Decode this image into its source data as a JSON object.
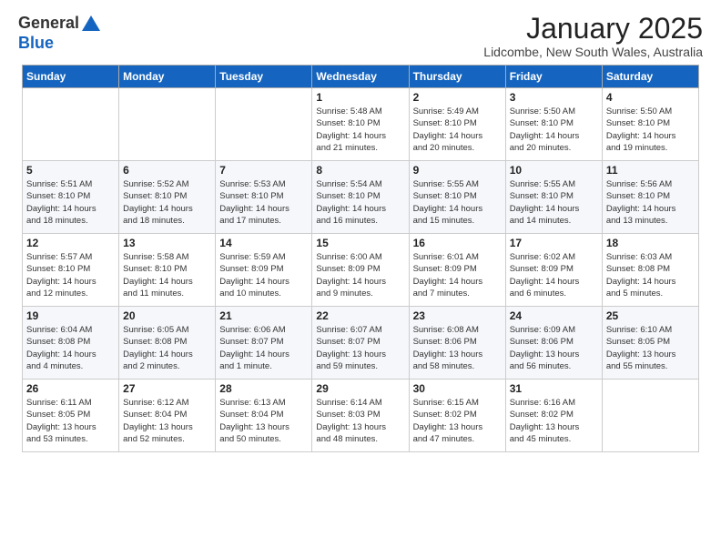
{
  "header": {
    "logo_general": "General",
    "logo_blue": "Blue",
    "month_title": "January 2025",
    "location": "Lidcombe, New South Wales, Australia"
  },
  "weekdays": [
    "Sunday",
    "Monday",
    "Tuesday",
    "Wednesday",
    "Thursday",
    "Friday",
    "Saturday"
  ],
  "weeks": [
    [
      {
        "day": "",
        "info": ""
      },
      {
        "day": "",
        "info": ""
      },
      {
        "day": "",
        "info": ""
      },
      {
        "day": "1",
        "info": "Sunrise: 5:48 AM\nSunset: 8:10 PM\nDaylight: 14 hours\nand 21 minutes."
      },
      {
        "day": "2",
        "info": "Sunrise: 5:49 AM\nSunset: 8:10 PM\nDaylight: 14 hours\nand 20 minutes."
      },
      {
        "day": "3",
        "info": "Sunrise: 5:50 AM\nSunset: 8:10 PM\nDaylight: 14 hours\nand 20 minutes."
      },
      {
        "day": "4",
        "info": "Sunrise: 5:50 AM\nSunset: 8:10 PM\nDaylight: 14 hours\nand 19 minutes."
      }
    ],
    [
      {
        "day": "5",
        "info": "Sunrise: 5:51 AM\nSunset: 8:10 PM\nDaylight: 14 hours\nand 18 minutes."
      },
      {
        "day": "6",
        "info": "Sunrise: 5:52 AM\nSunset: 8:10 PM\nDaylight: 14 hours\nand 18 minutes."
      },
      {
        "day": "7",
        "info": "Sunrise: 5:53 AM\nSunset: 8:10 PM\nDaylight: 14 hours\nand 17 minutes."
      },
      {
        "day": "8",
        "info": "Sunrise: 5:54 AM\nSunset: 8:10 PM\nDaylight: 14 hours\nand 16 minutes."
      },
      {
        "day": "9",
        "info": "Sunrise: 5:55 AM\nSunset: 8:10 PM\nDaylight: 14 hours\nand 15 minutes."
      },
      {
        "day": "10",
        "info": "Sunrise: 5:55 AM\nSunset: 8:10 PM\nDaylight: 14 hours\nand 14 minutes."
      },
      {
        "day": "11",
        "info": "Sunrise: 5:56 AM\nSunset: 8:10 PM\nDaylight: 14 hours\nand 13 minutes."
      }
    ],
    [
      {
        "day": "12",
        "info": "Sunrise: 5:57 AM\nSunset: 8:10 PM\nDaylight: 14 hours\nand 12 minutes."
      },
      {
        "day": "13",
        "info": "Sunrise: 5:58 AM\nSunset: 8:10 PM\nDaylight: 14 hours\nand 11 minutes."
      },
      {
        "day": "14",
        "info": "Sunrise: 5:59 AM\nSunset: 8:09 PM\nDaylight: 14 hours\nand 10 minutes."
      },
      {
        "day": "15",
        "info": "Sunrise: 6:00 AM\nSunset: 8:09 PM\nDaylight: 14 hours\nand 9 minutes."
      },
      {
        "day": "16",
        "info": "Sunrise: 6:01 AM\nSunset: 8:09 PM\nDaylight: 14 hours\nand 7 minutes."
      },
      {
        "day": "17",
        "info": "Sunrise: 6:02 AM\nSunset: 8:09 PM\nDaylight: 14 hours\nand 6 minutes."
      },
      {
        "day": "18",
        "info": "Sunrise: 6:03 AM\nSunset: 8:08 PM\nDaylight: 14 hours\nand 5 minutes."
      }
    ],
    [
      {
        "day": "19",
        "info": "Sunrise: 6:04 AM\nSunset: 8:08 PM\nDaylight: 14 hours\nand 4 minutes."
      },
      {
        "day": "20",
        "info": "Sunrise: 6:05 AM\nSunset: 8:08 PM\nDaylight: 14 hours\nand 2 minutes."
      },
      {
        "day": "21",
        "info": "Sunrise: 6:06 AM\nSunset: 8:07 PM\nDaylight: 14 hours\nand 1 minute."
      },
      {
        "day": "22",
        "info": "Sunrise: 6:07 AM\nSunset: 8:07 PM\nDaylight: 13 hours\nand 59 minutes."
      },
      {
        "day": "23",
        "info": "Sunrise: 6:08 AM\nSunset: 8:06 PM\nDaylight: 13 hours\nand 58 minutes."
      },
      {
        "day": "24",
        "info": "Sunrise: 6:09 AM\nSunset: 8:06 PM\nDaylight: 13 hours\nand 56 minutes."
      },
      {
        "day": "25",
        "info": "Sunrise: 6:10 AM\nSunset: 8:05 PM\nDaylight: 13 hours\nand 55 minutes."
      }
    ],
    [
      {
        "day": "26",
        "info": "Sunrise: 6:11 AM\nSunset: 8:05 PM\nDaylight: 13 hours\nand 53 minutes."
      },
      {
        "day": "27",
        "info": "Sunrise: 6:12 AM\nSunset: 8:04 PM\nDaylight: 13 hours\nand 52 minutes."
      },
      {
        "day": "28",
        "info": "Sunrise: 6:13 AM\nSunset: 8:04 PM\nDaylight: 13 hours\nand 50 minutes."
      },
      {
        "day": "29",
        "info": "Sunrise: 6:14 AM\nSunset: 8:03 PM\nDaylight: 13 hours\nand 48 minutes."
      },
      {
        "day": "30",
        "info": "Sunrise: 6:15 AM\nSunset: 8:02 PM\nDaylight: 13 hours\nand 47 minutes."
      },
      {
        "day": "31",
        "info": "Sunrise: 6:16 AM\nSunset: 8:02 PM\nDaylight: 13 hours\nand 45 minutes."
      },
      {
        "day": "",
        "info": ""
      }
    ]
  ]
}
